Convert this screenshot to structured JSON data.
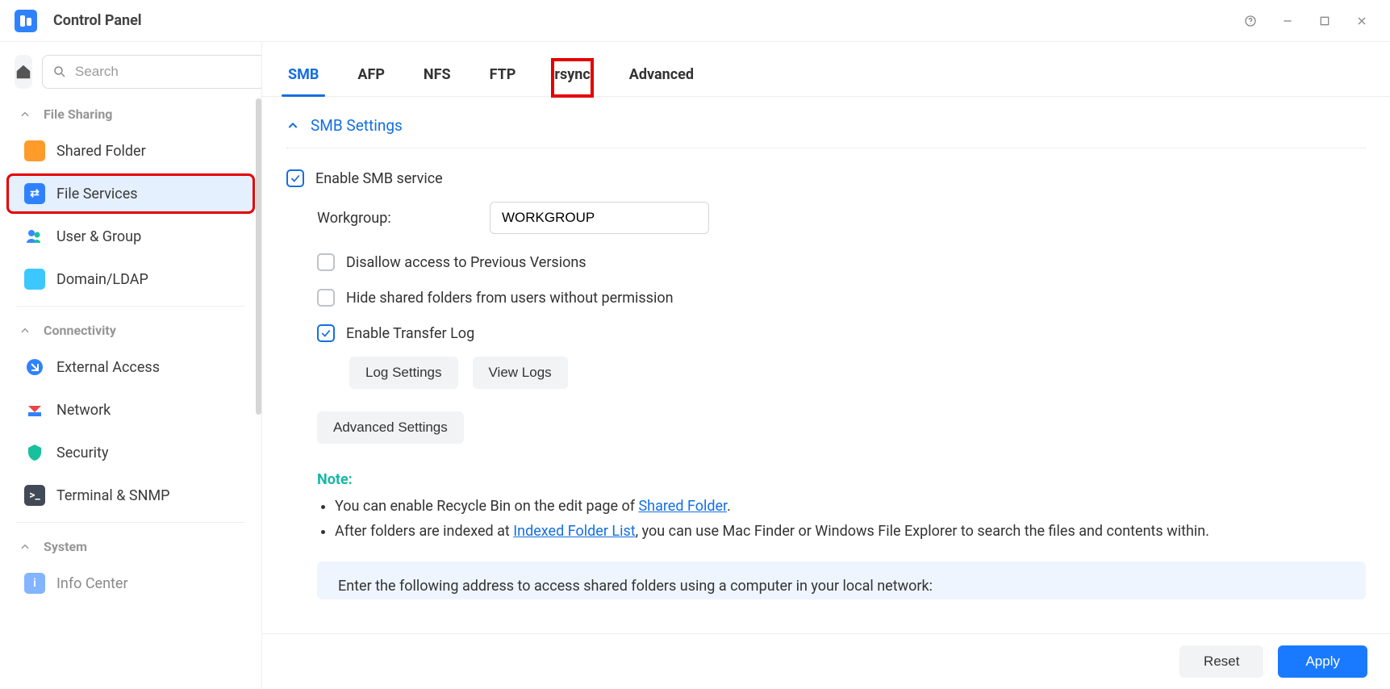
{
  "window": {
    "title": "Control Panel"
  },
  "sidebar": {
    "search_placeholder": "Search",
    "groups": [
      {
        "label": "File Sharing",
        "items": [
          {
            "id": "shared-folder",
            "label": "Shared Folder"
          },
          {
            "id": "file-services",
            "label": "File Services",
            "active": true
          },
          {
            "id": "user-group",
            "label": "User & Group"
          },
          {
            "id": "domain-ldap",
            "label": "Domain/LDAP"
          }
        ]
      },
      {
        "label": "Connectivity",
        "items": [
          {
            "id": "external-access",
            "label": "External Access"
          },
          {
            "id": "network",
            "label": "Network"
          },
          {
            "id": "security",
            "label": "Security"
          },
          {
            "id": "terminal-snmp",
            "label": "Terminal & SNMP"
          }
        ]
      },
      {
        "label": "System",
        "items": [
          {
            "id": "info-center",
            "label": "Info Center"
          }
        ]
      }
    ]
  },
  "tabs": [
    "SMB",
    "AFP",
    "NFS",
    "FTP",
    "rsync",
    "Advanced"
  ],
  "tabs_active": 0,
  "tabs_highlight": 4,
  "smb": {
    "section_title": "SMB Settings",
    "enable_label": "Enable SMB service",
    "enable_checked": true,
    "workgroup_label": "Workgroup:",
    "workgroup_value": "WORKGROUP",
    "disallow_prev_label": "Disallow access to Previous Versions",
    "disallow_prev_checked": false,
    "hide_folders_label": "Hide shared folders from users without permission",
    "hide_folders_checked": false,
    "transfer_log_label": "Enable Transfer Log",
    "transfer_log_checked": true,
    "log_settings_btn": "Log Settings",
    "view_logs_btn": "View Logs",
    "advanced_btn": "Advanced Settings",
    "note_head": "Note:",
    "note1_a": "You can enable Recycle Bin on the edit page of ",
    "note1_link": "Shared Folder",
    "note1_b": ".",
    "note2_a": "After folders are indexed at ",
    "note2_link": "Indexed Folder List",
    "note2_b": ", you can use Mac Finder or Windows File Explorer to search the files and contents within.",
    "info_box": "Enter the following address to access shared folders using a computer in your local network:"
  },
  "footer": {
    "reset": "Reset",
    "apply": "Apply"
  }
}
